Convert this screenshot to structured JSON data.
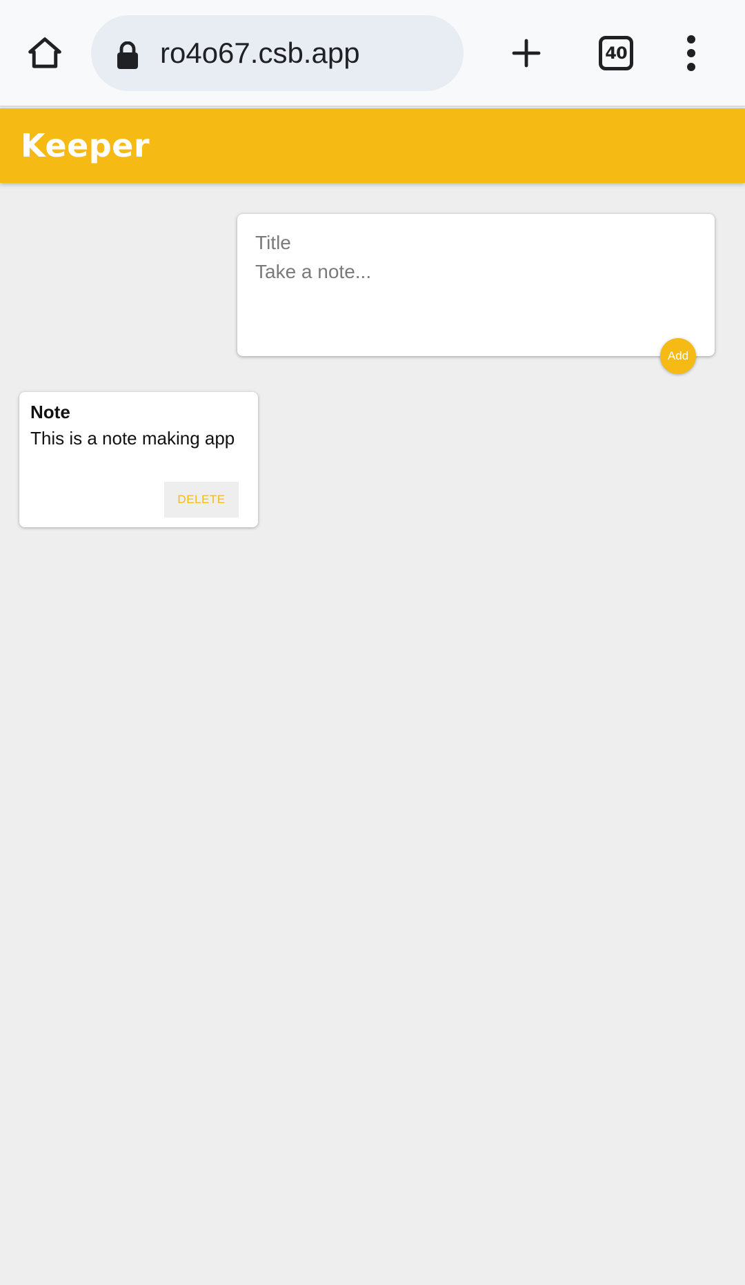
{
  "browser": {
    "url": "ro4o67.csb.app",
    "tab_count": "40",
    "icons": {
      "home": "home-icon",
      "lock": "lock-icon",
      "new_tab": "plus-icon",
      "tabs": "tab-switcher-icon",
      "menu": "more-vert-icon"
    }
  },
  "app": {
    "title": "Keeper",
    "accent_color": "#f5ba13",
    "background_color": "#eeeeee"
  },
  "create_note": {
    "title_placeholder": "Title",
    "content_placeholder": "Take a note...",
    "add_label": "Add"
  },
  "notes": [
    {
      "title": "Note",
      "content": "This is a note making app",
      "delete_label": "DELETE"
    }
  ]
}
